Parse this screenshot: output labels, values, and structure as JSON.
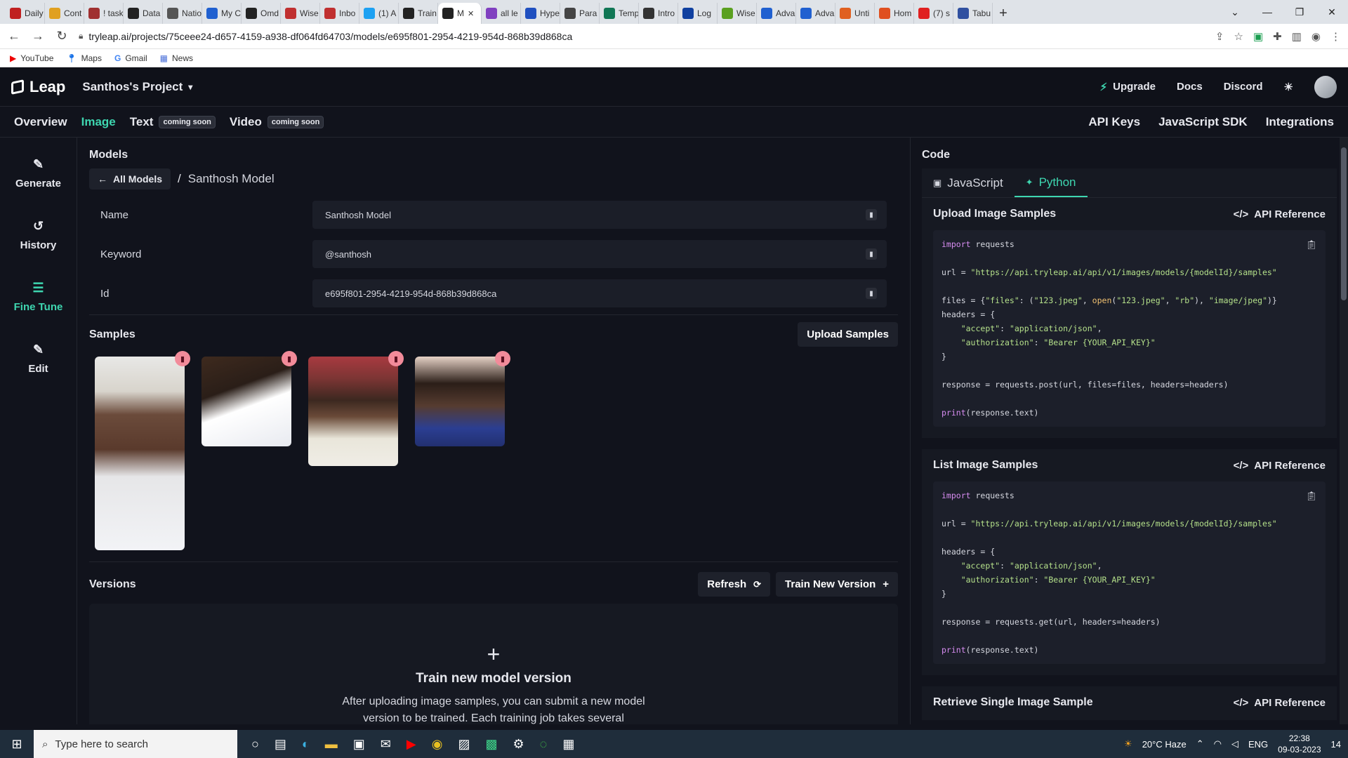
{
  "browser": {
    "tabs": [
      "Daily",
      "Cont",
      "! task",
      "Data",
      "Natio",
      "My C",
      "Omd",
      "Wise",
      "Inbo",
      "(1) A",
      "Train",
      "M",
      "all le",
      "Hype",
      "Para",
      "Temp",
      "Intro",
      "Log",
      "Wise",
      "Adva",
      "Adva",
      "Unti",
      "Hom",
      "(7) s",
      "Tabu"
    ],
    "tab_colors": [
      "#c02020",
      "#e0a020",
      "#a03030",
      "#222222",
      "#555555",
      "#2060d0",
      "#222222",
      "#c03030",
      "#c03030",
      "#1da1f2",
      "#222222",
      "#222222",
      "#8040c0",
      "#2050c0",
      "#444444",
      "#117755",
      "#333333",
      "#1040a0",
      "#5aa020",
      "#2060d0",
      "#2060d0",
      "#e06020",
      "#e05020",
      "#e02020",
      "#3050a0"
    ],
    "url": "tryleap.ai/projects/75ceee24-d657-4159-a938-df064fd64703/models/e695f801-2954-4219-954d-868b39d868ca",
    "bookmarks": [
      "YouTube",
      "Maps",
      "Gmail",
      "News"
    ]
  },
  "header": {
    "logo": "Leap",
    "project": "Santhos's Project",
    "upgrade": "Upgrade",
    "docs": "Docs",
    "discord": "Discord"
  },
  "subnav": {
    "overview": "Overview",
    "image": "Image",
    "text": "Text",
    "video": "Video",
    "coming_soon": "coming soon",
    "api_keys": "API Keys",
    "sdk": "JavaScript SDK",
    "integrations": "Integrations"
  },
  "sidebar": {
    "items": [
      {
        "label": "Generate",
        "icon": "✎"
      },
      {
        "label": "History",
        "icon": "↺"
      },
      {
        "label": "Fine Tune",
        "icon": "☰"
      },
      {
        "label": "Edit",
        "icon": "✎"
      }
    ]
  },
  "model": {
    "section": "Models",
    "back": "All Models",
    "name_crumb": "Santhosh Model",
    "fields": [
      {
        "label": "Name",
        "value": "Santhosh Model"
      },
      {
        "label": "Keyword",
        "value": "@santhosh"
      },
      {
        "label": "Id",
        "value": "e695f801-2954-4219-954d-868b39d868ca"
      }
    ]
  },
  "samples": {
    "title": "Samples",
    "upload": "Upload Samples"
  },
  "versions": {
    "title": "Versions",
    "refresh": "Refresh",
    "train": "Train New Version",
    "box_title": "Train new model version",
    "box_desc": "After uploading image samples, you can submit a new model version to be trained. Each training job takes several"
  },
  "code": {
    "title": "Code",
    "tabs": [
      "JavaScript",
      "Python"
    ],
    "api_ref": "API Reference",
    "sections": [
      "Upload Image Samples",
      "List Image Samples",
      "Retrieve Single Image Sample"
    ],
    "upload_url": "\"https://api.tryleap.ai/api/v1/images/models/{modelId}/samples\""
  },
  "taskbar": {
    "search": "Type here to search",
    "weather": "20°C  Haze",
    "lang": "ENG",
    "time": "22:38",
    "date": "09-03-2023",
    "notif": "14"
  }
}
